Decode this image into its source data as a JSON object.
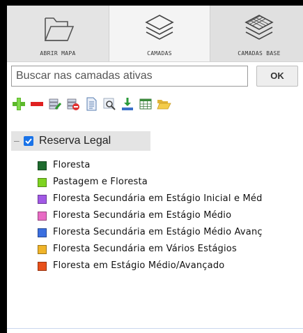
{
  "toolbar": {
    "open_map_label": "ABRIR MAPA",
    "layers_label": "CAMADAS",
    "base_layers_label": "CAMADAS BASE"
  },
  "search": {
    "placeholder": "Buscar nas camadas ativas",
    "ok_label": "OK"
  },
  "tools": [
    {
      "icon": "add-icon"
    },
    {
      "icon": "remove-icon"
    },
    {
      "icon": "layer-edit-icon"
    },
    {
      "icon": "layer-remove-icon"
    },
    {
      "icon": "document-icon"
    },
    {
      "icon": "zoom-layer-icon"
    },
    {
      "icon": "download-icon"
    },
    {
      "icon": "table-icon"
    },
    {
      "icon": "folder-open-icon"
    }
  ],
  "tree": {
    "group": {
      "label": "Reserva Legal",
      "checked": true,
      "collapse_symbol": "–"
    },
    "items": [
      {
        "label": "Floresta",
        "color": "#1e6b2e"
      },
      {
        "label": "Pastagem e Floresta",
        "color": "#7ed321"
      },
      {
        "label": "Floresta Secundária em Estágio Inicial e Méd",
        "color": "#a259e6"
      },
      {
        "label": "Floresta Secundária em Estágio Médio",
        "color": "#e86bc4"
      },
      {
        "label": "Floresta Secundária em Estágio Médio Avanç",
        "color": "#3b6fe0"
      },
      {
        "label": "Floresta Secundária em Vários Estágios",
        "color": "#f0b429"
      },
      {
        "label": "Floresta em Estágio Médio/Avançado",
        "color": "#e8501a"
      }
    ]
  }
}
